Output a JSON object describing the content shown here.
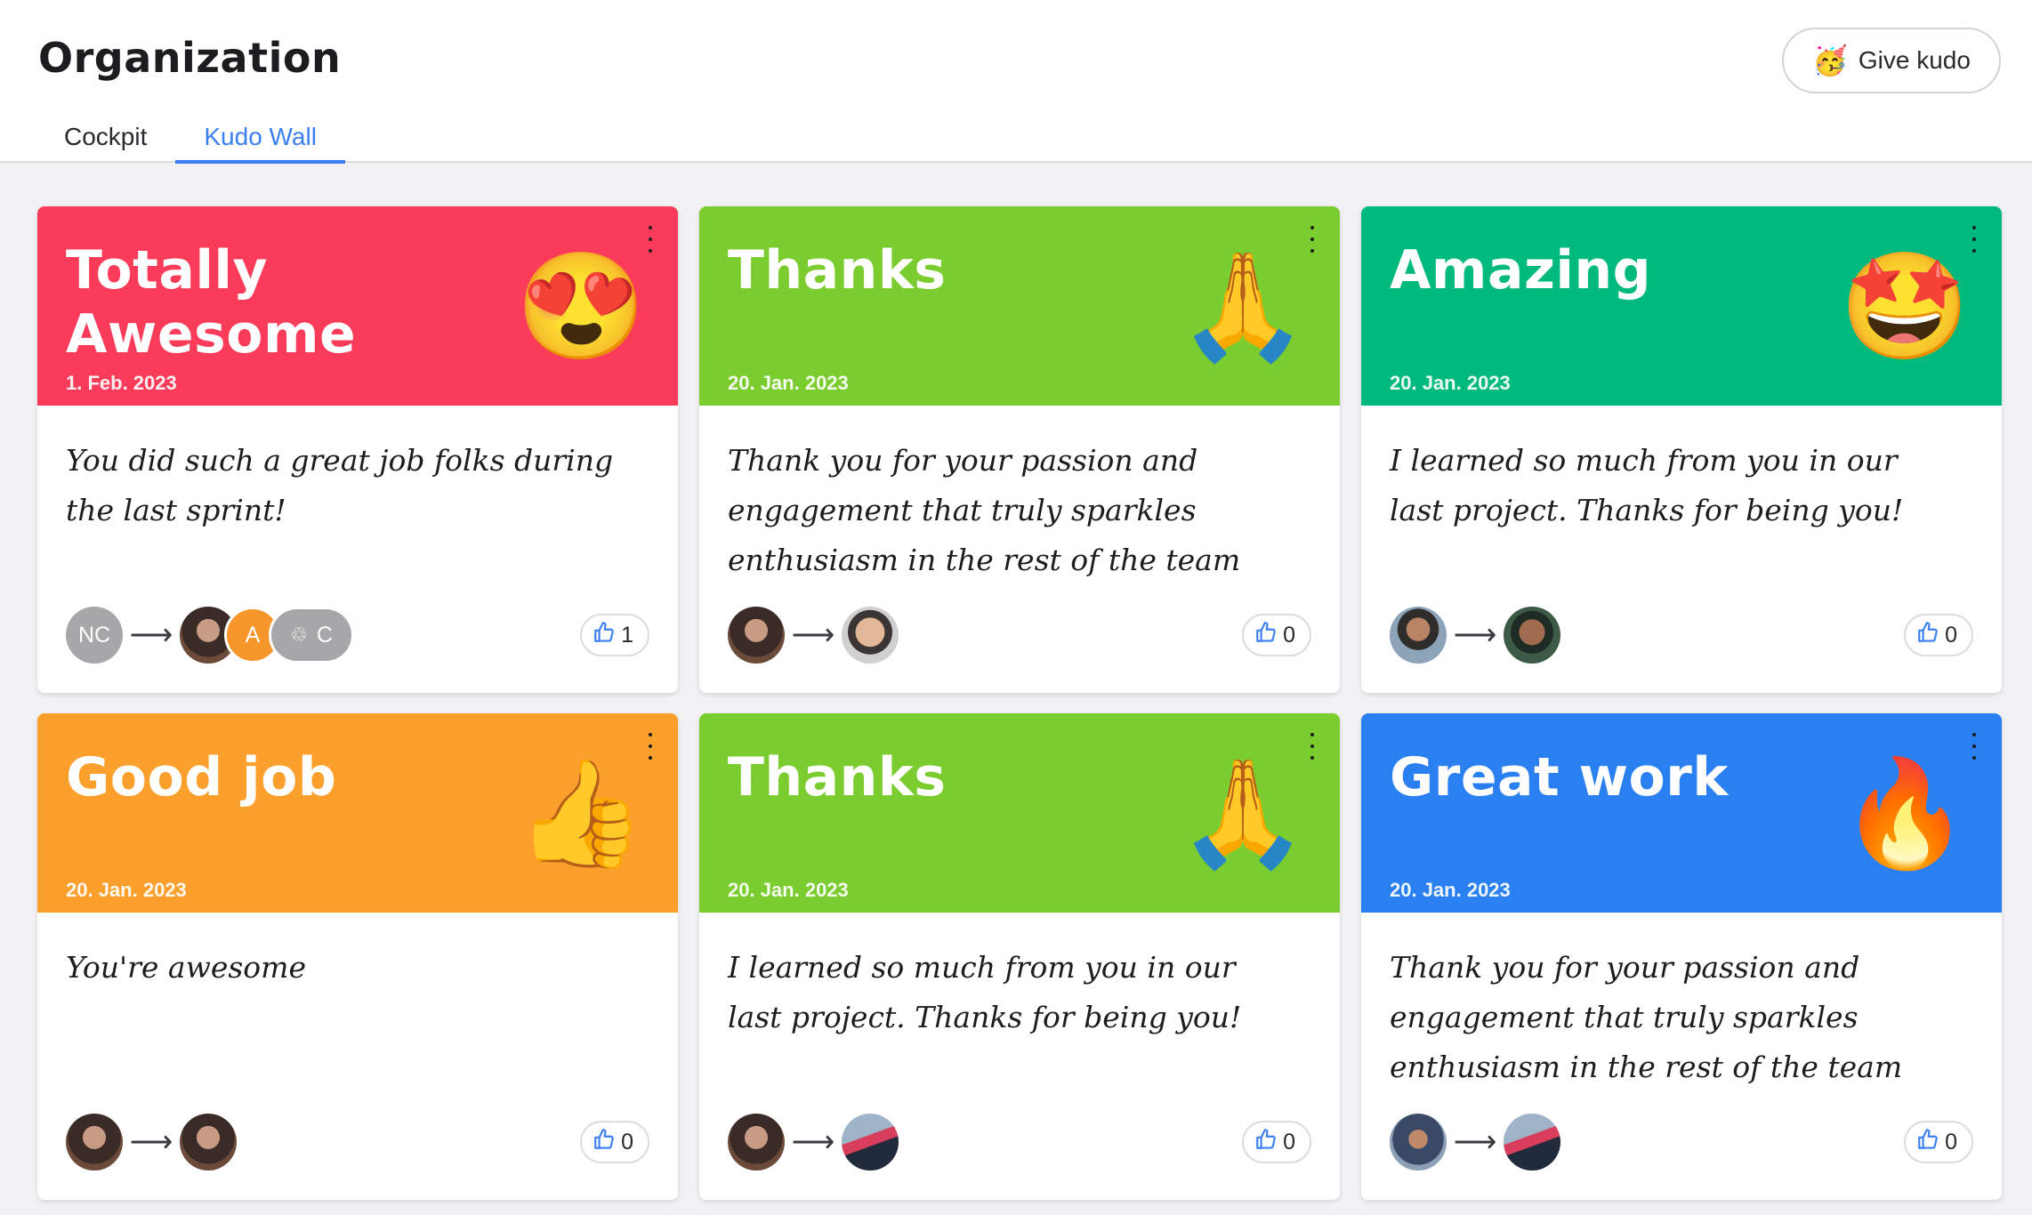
{
  "header": {
    "title": "Organization",
    "give_kudo_label": "Give kudo",
    "give_kudo_icon": "🥳"
  },
  "tabs": [
    {
      "label": "Cockpit",
      "active": false
    },
    {
      "label": "Kudo Wall",
      "active": true
    }
  ],
  "colors": {
    "red": "#fa3c5a",
    "green": "#7bcc2e",
    "teal": "#00b97c",
    "orange": "#fba02d",
    "blue": "#2a80f0",
    "accent": "#3b7ff0"
  },
  "cards": [
    {
      "title": "Totally Awesome",
      "date": "1. Feb. 2023",
      "emoji": "😍",
      "emoji_name": "heart-eyes-emoji",
      "color": "#fa3c5a",
      "message": "You did such a great job folks during the last sprint!",
      "sender": {
        "initials": "NC"
      },
      "recipients": [
        {
          "photo": "photo-1"
        },
        {
          "initials": "A"
        },
        {
          "initials": "C",
          "icon": "♲"
        }
      ],
      "likes": "1"
    },
    {
      "title": "Thanks",
      "date": "20. Jan. 2023",
      "emoji": "🙏",
      "emoji_name": "folded-hands-emoji",
      "color": "#7bcc2e",
      "message": "Thank you for your passion and engagement that truly sparkles enthusiasm in the rest of the team",
      "sender": {
        "photo": "photo-1"
      },
      "recipients": [
        {
          "photo": "photo-2"
        }
      ],
      "likes": "0"
    },
    {
      "title": "Amazing",
      "date": "20. Jan. 2023",
      "emoji": "🤩",
      "emoji_name": "star-struck-emoji",
      "color": "#00b97c",
      "message": "I learned so much from you in our last project. Thanks for being you!",
      "sender": {
        "photo": "photo-3"
      },
      "recipients": [
        {
          "photo": "photo-4"
        }
      ],
      "likes": "0"
    },
    {
      "title": "Good job",
      "date": "20. Jan. 2023",
      "emoji": "👍",
      "emoji_name": "thumbs-up-emoji",
      "color": "#fba02d",
      "message": "You're awesome",
      "sender": {
        "photo": "photo-1"
      },
      "recipients": [
        {
          "photo": "photo-1"
        }
      ],
      "likes": "0"
    },
    {
      "title": "Thanks",
      "date": "20. Jan. 2023",
      "emoji": "🙏",
      "emoji_name": "folded-hands-emoji",
      "color": "#7bcc2e",
      "message": "I learned so much from you in our last project. Thanks for being you!",
      "sender": {
        "photo": "photo-1"
      },
      "recipients": [
        {
          "photo": "photo-5"
        }
      ],
      "likes": "0"
    },
    {
      "title": "Great work",
      "date": "20. Jan. 2023",
      "emoji": "🔥",
      "emoji_name": "fire-emoji",
      "color": "#2a80f0",
      "message": "Thank you for your passion and engagement that truly sparkles enthusiasm in the rest of the team",
      "sender": {
        "photo": "photo-6"
      },
      "recipients": [
        {
          "photo": "photo-5"
        }
      ],
      "likes": "0"
    }
  ]
}
